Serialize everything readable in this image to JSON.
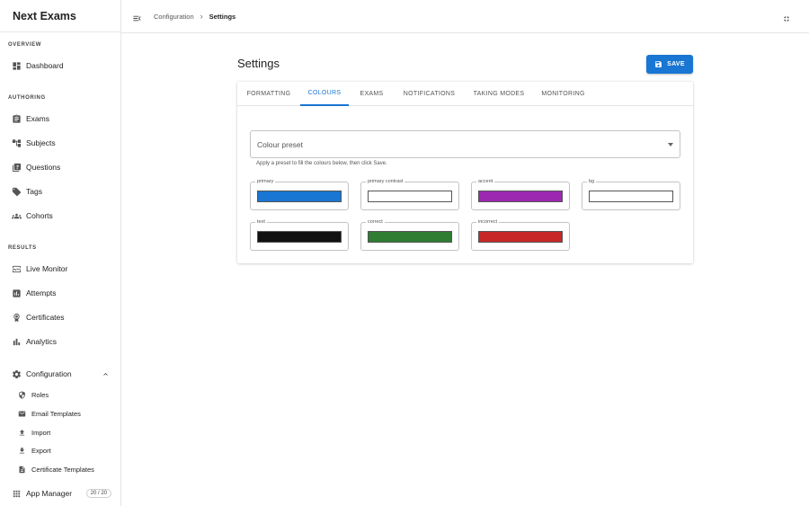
{
  "app": {
    "title": "Next Exams"
  },
  "sidebar": {
    "sections": {
      "overview": "OVERVIEW",
      "authoring": "AUTHORING",
      "results": "RESULTS"
    },
    "items": {
      "dashboard": "Dashboard",
      "exams": "Exams",
      "subjects": "Subjects",
      "questions": "Questions",
      "tags": "Tags",
      "cohorts": "Cohorts",
      "live_monitor": "Live Monitor",
      "attempts": "Attempts",
      "certificates": "Certificates",
      "analytics": "Analytics",
      "configuration": "Configuration",
      "app_manager": "App Manager"
    },
    "config_sub": {
      "roles": "Roles",
      "email_templates": "Email Templates",
      "import": "Import",
      "export": "Export",
      "certificate_templates": "Certificate Templates"
    },
    "app_manager_badge": "20 / 20"
  },
  "topbar": {
    "breadcrumb_parent": "Configuration",
    "breadcrumb_sep": "›",
    "breadcrumb_current": "Settings"
  },
  "main": {
    "title": "Settings",
    "save_label": "SAVE",
    "tabs": [
      "FORMATTING",
      "COLOURS",
      "EXAMS",
      "NOTIFICATIONS",
      "TAKING MODES",
      "MONITORING"
    ],
    "active_tab": "COLOURS",
    "preset_placeholder": "Colour preset",
    "preset_helper": "Apply a preset to fill the colours below, then click Save.",
    "colors": [
      {
        "label": "primary",
        "value": "#1976d2"
      },
      {
        "label": "primary contrast",
        "value": "#ffffff"
      },
      {
        "label": "accent",
        "value": "#9c27b0"
      },
      {
        "label": "bg",
        "value": "#ffffff"
      },
      {
        "label": "text",
        "value": "#111111"
      },
      {
        "label": "correct",
        "value": "#2e7d32"
      },
      {
        "label": "incorrect",
        "value": "#c62828"
      }
    ]
  }
}
